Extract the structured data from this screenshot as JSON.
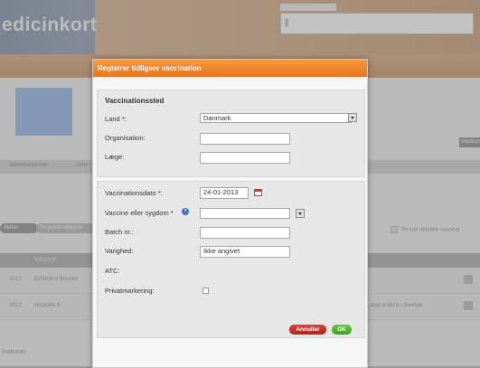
{
  "background": {
    "app_title": "edicinkort",
    "header_top_label": "...",
    "tabs": [
      "Administrationer",
      "Aktiv"
    ],
    "right_button_label": "Medicin",
    "pill_left": "Aktion",
    "pill_register": "Registrer tidligere",
    "filter_label": "Vis kun aktuelle vaccinat",
    "table_header_vaccine": "Vaccine",
    "rows": [
      {
        "year": "2013",
        "vaccine": "DiTeKiPol Booster",
        "extra": ""
      },
      {
        "year": "2012",
        "vaccine": "Hepatitis A",
        "extra": "Læge praksis i Sverige"
      }
    ],
    "footer_text": "inationer"
  },
  "modal": {
    "title": "Registrer tidligere vaccination",
    "place_section_title": "Vaccinationssted",
    "country_label": "Land *:",
    "country_value": "Danmark",
    "organisation_label": "Organisation:",
    "organisation_value": "",
    "doctor_label": "Læge:",
    "doctor_value": "",
    "date_label": "Vaccinationsdato *:",
    "date_value": "24-01-2013",
    "vaccine_label": "Vaccine eller sygdom *",
    "vaccine_value": "",
    "batch_label": "Batch nr.:",
    "batch_value": "",
    "duration_label": "Varighed:",
    "duration_value": "Ikke angivet",
    "atc_label": "ATC:",
    "private_label": "Privatmarkering:",
    "cancel_label": "Annuller",
    "ok_label": "OK"
  },
  "colors": {
    "modal_header": "#e8741f",
    "cancel_button": "#c2281e",
    "ok_button": "#4aa82a"
  }
}
